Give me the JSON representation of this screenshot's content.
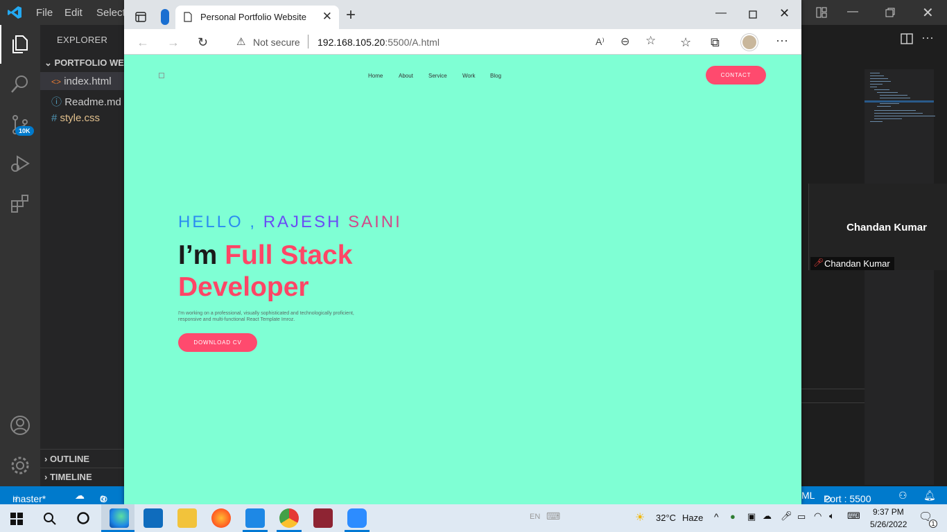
{
  "vscode": {
    "menu": [
      "File",
      "Edit",
      "Selecti"
    ],
    "sidebar": {
      "header": "EXPLORER",
      "project": "PORTFOLIO WE",
      "files": [
        {
          "name": "index.html",
          "icon": "<>"
        },
        {
          "name": "Readme.md",
          "icon": "i"
        },
        {
          "name": "style.css",
          "icon": "#"
        }
      ],
      "outline": "OUTLINE",
      "timeline": "TIMELINE"
    },
    "activity_badge": "10K",
    "statusbar": {
      "branch": "master*",
      "errors": "0",
      "lang": "ML",
      "port": "Port : 5500"
    }
  },
  "zoom": {
    "participant_name": "Chandan Kumar",
    "label": "Chandan Kumar"
  },
  "browser": {
    "tab_title": "Personal Portfolio Website",
    "not_secure": "Not secure",
    "url_host": "192.168.105.20",
    "url_path": ":5500/A.html"
  },
  "page": {
    "nav": [
      "Home",
      "About",
      "Service",
      "Work",
      "Blog"
    ],
    "contact_label": "CONTACT",
    "hello_1": "HELLO , ",
    "hello_2": "RAJESH",
    "hello_3": " SAINI",
    "headline_dark": "I’m ",
    "headline_pink_1": "Full Stack",
    "headline_pink_2": "Developer",
    "description": "I'm working on a professional, visually sophisticated and technologically proficient, responsive and multi-functional React Template Imroz.",
    "download_label": "DOWNLOAD CV"
  },
  "taskbar": {
    "lang": "EN",
    "weather": "32°C",
    "weather_desc": "Haze",
    "time": "9:37 PM",
    "date": "5/26/2022",
    "notif_count": "1"
  },
  "colors": {
    "page_bg": "#7fffd4",
    "accent_pink": "#ff4a6e",
    "vscode_blue": "#007acc"
  }
}
